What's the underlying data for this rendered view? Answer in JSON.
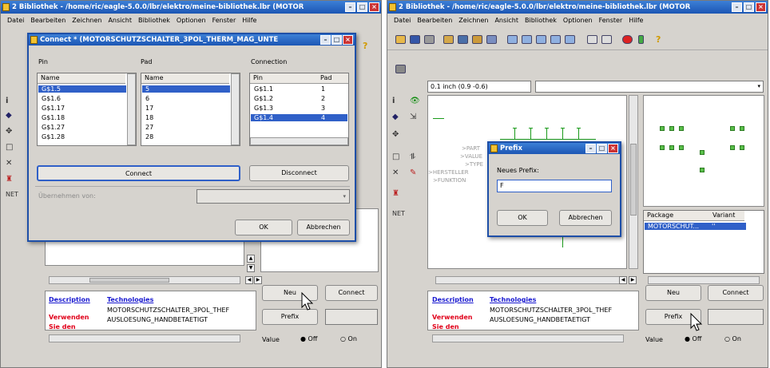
{
  "left": {
    "title": "2 Bibliothek - /home/ric/eagle-5.0.0/lbr/elektro/meine-bibliothek.lbr (MOTOR",
    "menu": [
      "Datei",
      "Bearbeiten",
      "Zeichnen",
      "Ansicht",
      "Bibliothek",
      "Optionen",
      "Fenster",
      "Hilfe"
    ],
    "buttons": {
      "neu": "Neu",
      "connect": "Connect",
      "prefix": "Prefix"
    },
    "value_label": "Value",
    "off": "Off",
    "on": "On",
    "desc_link": "Description",
    "tech_link": "Technologies",
    "tech_items": [
      "MOTORSCHUTZSCHALTER_3POL_THEF",
      "AUSLOESUNG_HANDBETAETIGT"
    ],
    "warn": [
      "Verwenden",
      "Sie den"
    ],
    "dialog": {
      "title": "Connect * (MOTORSCHUTZSCHALTER_3POL_THERM_MAG_UNTE",
      "pin_label": "Pin",
      "pad_label": "Pad",
      "connection_label": "Connection",
      "col_name": "Name",
      "col_pin": "Pin",
      "col_pad": "Pad",
      "pins": [
        "G$1.5",
        "G$1.6",
        "G$1.17",
        "G$1.18",
        "G$1.27",
        "G$1.28"
      ],
      "pads": [
        "5",
        "6",
        "17",
        "18",
        "27",
        "28"
      ],
      "connections": [
        [
          "G$1.1",
          "1"
        ],
        [
          "G$1.2",
          "2"
        ],
        [
          "G$1.3",
          "3"
        ],
        [
          "G$1.4",
          "4"
        ]
      ],
      "connect": "Connect",
      "disconnect": "Disconnect",
      "copy_from": "Übernehmen von:",
      "ok": "OK",
      "cancel": "Abbrechen"
    }
  },
  "right": {
    "title": "2 Bibliothek - /home/ric/eagle-5.0.0/lbr/elektro/meine-bibliothek.lbr (MOTOR",
    "menu": [
      "Datei",
      "Bearbeiten",
      "Zeichnen",
      "Ansicht",
      "Bibliothek",
      "Optionen",
      "Fenster",
      "Hilfe"
    ],
    "grid": "0.1 inch (0.9 -0.6)",
    "symbol_texts": [
      ">PART",
      ">VALUE",
      ">TYPE",
      ">HERSTELLER",
      ">FUNKTION"
    ],
    "table": {
      "col_package": "Package",
      "col_variant": "Variant",
      "row_package": "MOTORSCHUT...",
      "row_variant": "''"
    },
    "buttons": {
      "neu": "Neu",
      "connect": "Connect",
      "prefix": "Prefix"
    },
    "value_label": "Value",
    "off": "Off",
    "on": "On",
    "desc_link": "Description",
    "tech_link": "Technologies",
    "tech_items": [
      "MOTORSCHUTZSCHALTER_3POL_THEF",
      "AUSLOESUNG_HANDBETAETIGT"
    ],
    "warn": [
      "Verwenden",
      "Sie den"
    ],
    "dialog": {
      "title": "Prefix",
      "label": "Neues Prefix:",
      "value": "F",
      "ok": "OK",
      "cancel": "Abbrechen"
    }
  },
  "colors": {
    "titlebar": "#1c56b4",
    "selection": "#3060c8",
    "warn": "#e0001a",
    "link": "#1a1ad0",
    "pad": "#5ac04a"
  }
}
